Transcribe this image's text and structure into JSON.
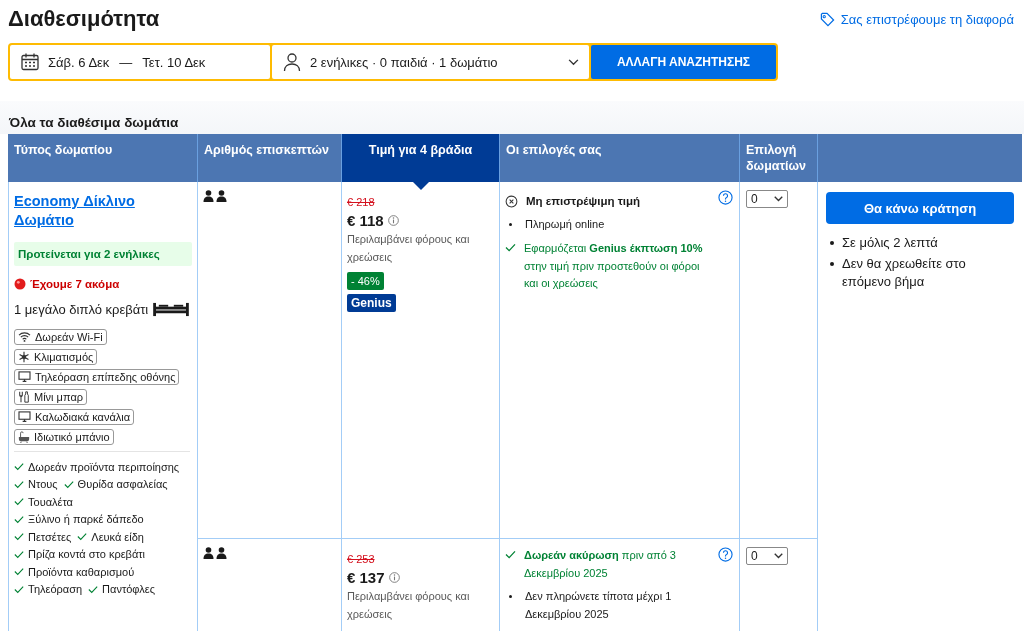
{
  "page_title": "Διαθεσιμότητα",
  "price_match_link": "Σας επιστρέφουμε τη διαφορά",
  "search_bar": {
    "checkin": "Σάβ. 6 Δεκ",
    "date_separator": "—",
    "checkout": "Τετ. 10 Δεκ",
    "guests": "2 ενήλικες · 0 παιδιά · 1 δωμάτιο",
    "button": "ΑΛΛΑΓΗ ΑΝΑΖΗΤΗΣΗΣ"
  },
  "section_title": "Όλα τα διαθέσιμα δωμάτια",
  "table": {
    "columns": [
      {
        "label": "Τύπος δωματίου",
        "selected": false
      },
      {
        "label": "Αριθμός επισκεπτών",
        "selected": false
      },
      {
        "label": "Τιμή για 4 βράδια",
        "selected": true
      },
      {
        "label": "Οι επιλογές σας",
        "selected": false
      },
      {
        "label": "Επιλογή δωματίων",
        "selected": false
      }
    ],
    "room": {
      "name": "Economy Δίκλινο Δωμάτιο",
      "recommendation": "Προτείνεται για 2 ενήλικες",
      "scarcity": "Έχουμε 7 ακόμα",
      "bed": "1 μεγάλο διπλό κρεβάτι",
      "facilities": [
        {
          "kind": "wifi",
          "label": "Δωρεάν Wi-Fi"
        },
        {
          "kind": "climate",
          "label": "Κλιματισμός"
        },
        {
          "kind": "tv",
          "label": "Τηλεόραση επίπεδης οθόνης"
        },
        {
          "kind": "minibar",
          "label": "Μίνι μπαρ"
        },
        {
          "kind": "tv",
          "label": "Καλωδιακά κανάλια"
        },
        {
          "kind": "bath",
          "label": "Ιδιωτικό μπάνιο"
        }
      ],
      "features": [
        "Δωρεάν προϊόντα περιποίησης",
        "Ντους",
        "Θυρίδα ασφαλείας",
        "Τουαλέτα",
        "Ξύλινο ή παρκέ δάπεδο",
        "Πετσέτες",
        "Λευκά είδη",
        "Πρίζα κοντά στο κρεβάτι",
        "Προϊόντα καθαρισμού",
        "Τηλεόραση",
        "Παντόφλες"
      ]
    },
    "options": [
      {
        "old_price": "€ 218",
        "price": "€ 118",
        "price_note": "Περιλαμβάνει φόρους και χρεώσεις",
        "discount": "- 46%",
        "genius_badge": "Genius",
        "rooms_selected": "0",
        "conditions": [
          {
            "kind": "policy",
            "text": "Μη επιστρέψιμη τιμή"
          },
          {
            "kind": "bullet",
            "text": "Πληρωμή online"
          },
          {
            "kind": "check",
            "text": "Εφαρμόζεται **Genius έκπτωση 10%** στην τιμή πριν προστεθούν οι φόροι και οι χρεώσεις"
          }
        ]
      },
      {
        "old_price": "€ 253",
        "price": "€ 137",
        "price_note": "Περιλαμβάνει φόρους και χρεώσεις",
        "rooms_selected": "0",
        "conditions": [
          {
            "kind": "check",
            "text": "**Δωρεάν ακύρωση** πριν από 3 Δεκεμβρίου 2025"
          },
          {
            "kind": "bullet",
            "text": "Δεν πληρώνετε τίποτα μέχρι 1 Δεκεμβρίου 2025"
          }
        ]
      }
    ],
    "booking": {
      "button": "Θα κάνω κράτηση",
      "notes": [
        "Σε μόλις 2 λεπτά",
        "Δεν θα χρεωθείτε στο επόμενο βήμα"
      ]
    }
  }
}
